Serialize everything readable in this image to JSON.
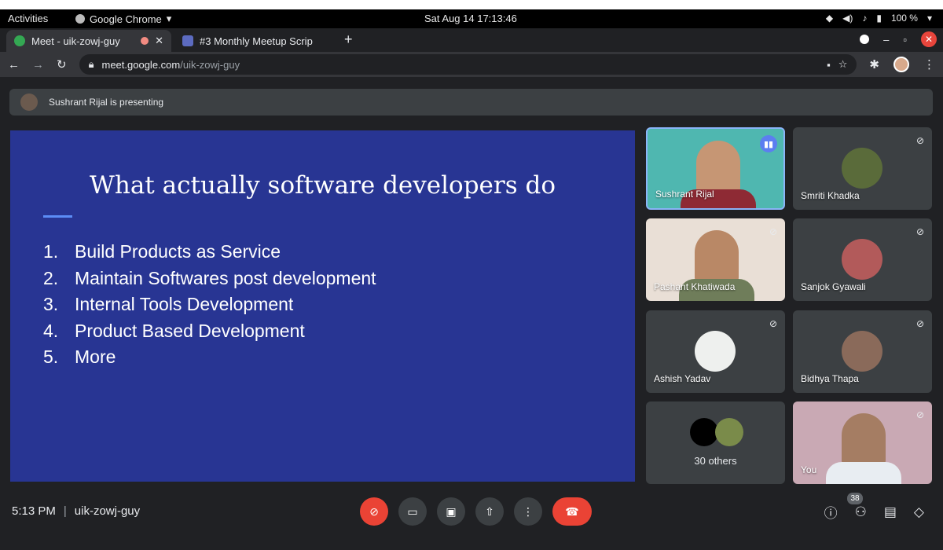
{
  "system": {
    "activities": "Activities",
    "app_name": "Google Chrome",
    "datetime": "Sat Aug 14  17:13:46",
    "battery": "100 %"
  },
  "browser": {
    "tabs": [
      {
        "label": "Meet - uik-zowj-guy"
      },
      {
        "label": "#3 Monthly Meetup Scrip"
      }
    ],
    "url_host": "meet.google.com",
    "url_path": "/uik-zowj-guy"
  },
  "meet": {
    "presenting_text": "Sushrant Rijal is presenting",
    "slide": {
      "title": "What actually software developers do",
      "items": [
        {
          "num": "1.",
          "text": "Build Products as Service"
        },
        {
          "num": "2.",
          "text": "Maintain Softwares post development"
        },
        {
          "num": "3.",
          "text": "Internal Tools Development"
        },
        {
          "num": "4.",
          "text": "Product Based Development"
        },
        {
          "num": "5.",
          "text": "More"
        }
      ]
    },
    "participants": [
      {
        "name": "Sushrant Rijal"
      },
      {
        "name": "Smriti Khadka"
      },
      {
        "name": "Pashant Khatiwada"
      },
      {
        "name": "Sanjok Gyawali"
      },
      {
        "name": "Ashish Yadav"
      },
      {
        "name": "Bidhya Thapa"
      },
      {
        "name": "30 others"
      },
      {
        "name": "You"
      }
    ],
    "time": "5:13 PM",
    "separator": "|",
    "meeting_code": "uik-zowj-guy",
    "people_count": "38"
  }
}
